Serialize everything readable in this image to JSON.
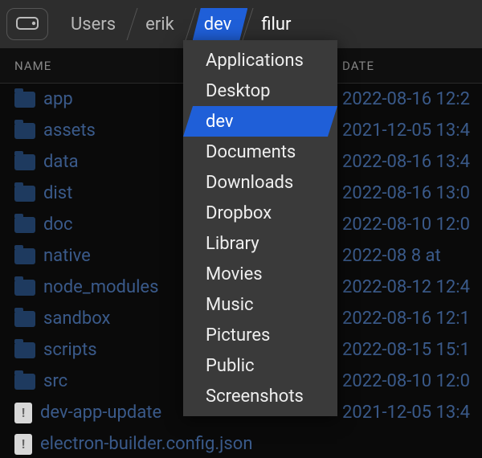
{
  "breadcrumb": {
    "items": [
      {
        "label": "Users",
        "active": false
      },
      {
        "label": "erik",
        "active": false
      },
      {
        "label": "dev",
        "active": true
      },
      {
        "label": "filur",
        "active": false,
        "last": true
      }
    ]
  },
  "columns": {
    "name": "NAME",
    "date": "DATE"
  },
  "rows": [
    {
      "icon": "folder",
      "name": "app",
      "date": "2022-08-16 12:2"
    },
    {
      "icon": "folder",
      "name": "assets",
      "date": "2021-12-05 13:4"
    },
    {
      "icon": "folder",
      "name": "data",
      "date": "2022-08-16 13:4"
    },
    {
      "icon": "folder",
      "name": "dist",
      "date": "2022-08-16 13:0"
    },
    {
      "icon": "folder",
      "name": "doc",
      "date": "2022-08-10 12:0"
    },
    {
      "icon": "folder",
      "name": "native",
      "date": "2022-08 8 at"
    },
    {
      "icon": "folder",
      "name": "node_modules",
      "date": "2022-08-12 12:4"
    },
    {
      "icon": "folder",
      "name": "sandbox",
      "date": "2022-08-16 12:1"
    },
    {
      "icon": "folder",
      "name": "scripts",
      "date": "2022-08-15 15:1"
    },
    {
      "icon": "folder",
      "name": "src",
      "date": "2022-08-10 12:0"
    },
    {
      "icon": "file",
      "name": "dev-app-update",
      "date": "2021-12-05 13:4"
    },
    {
      "icon": "file",
      "name": "electron-builder.config.json",
      "date": ""
    }
  ],
  "dropdown": {
    "items": [
      {
        "label": "Applications",
        "selected": false
      },
      {
        "label": "Desktop",
        "selected": false
      },
      {
        "label": "dev",
        "selected": true
      },
      {
        "label": "Documents",
        "selected": false
      },
      {
        "label": "Downloads",
        "selected": false
      },
      {
        "label": "Dropbox",
        "selected": false
      },
      {
        "label": "Library",
        "selected": false
      },
      {
        "label": "Movies",
        "selected": false
      },
      {
        "label": "Music",
        "selected": false
      },
      {
        "label": "Pictures",
        "selected": false
      },
      {
        "label": "Public",
        "selected": false
      },
      {
        "label": "Screenshots",
        "selected": false
      }
    ]
  },
  "icons": {
    "file_badge": "!"
  }
}
